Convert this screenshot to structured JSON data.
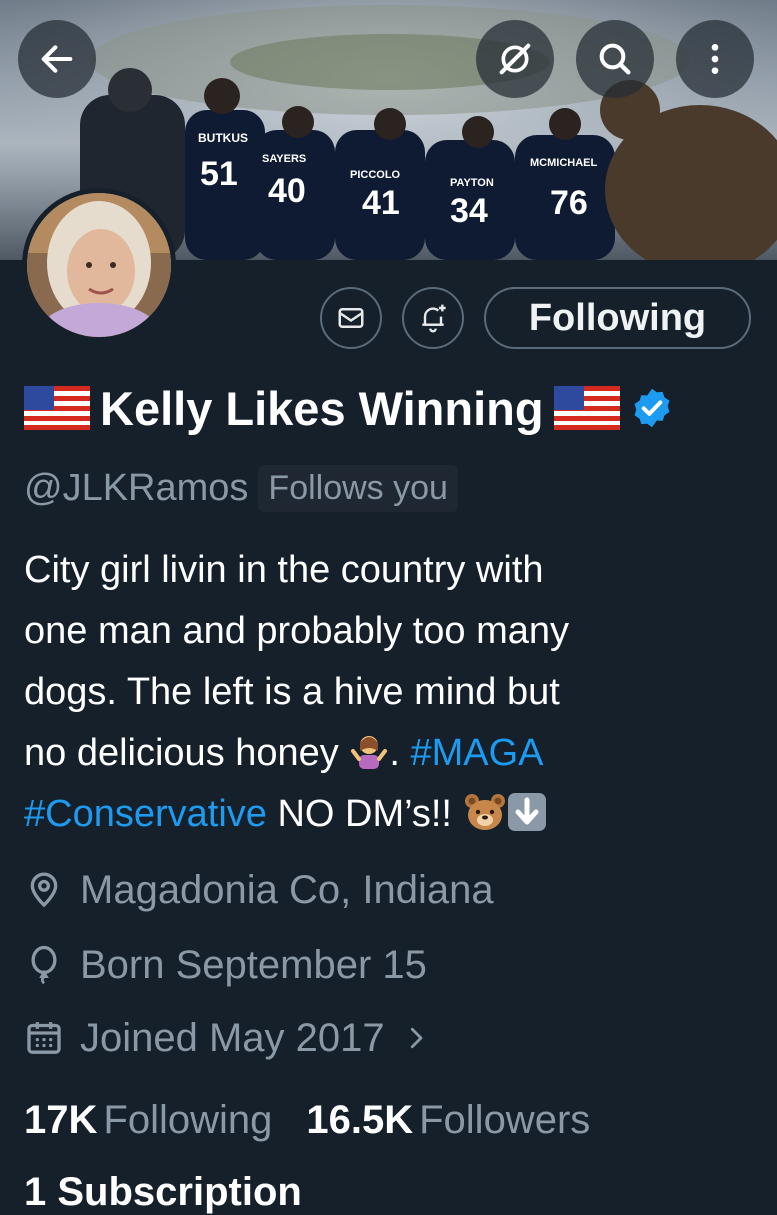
{
  "banner": {
    "jersey_names": [
      "BUTKUS",
      "SAYERS",
      "PICCOLO",
      "PAYTON",
      "MCMICHAEL"
    ],
    "jersey_numbers": [
      "51",
      "40",
      "41",
      "34",
      "76"
    ]
  },
  "profile": {
    "display_name": "Kelly Likes Winning",
    "handle": "@JLKRamos",
    "follows_you": "Follows you",
    "bio": {
      "line1": "City girl livin in the country with",
      "line2": "one man and probably too many",
      "line3": "dogs. The left is a hive mind but",
      "line4_a": "no delicious honey",
      "line4_b": ". ",
      "tag1": "#MAGA",
      "tag2": "#Conservative",
      "line5_b": " NO DM’s!! "
    },
    "location": "Magadonia Co, Indiana",
    "birthday": "Born September 15",
    "joined": "Joined May 2017",
    "following_count": "17K",
    "following_label": "Following",
    "followers_count": "16.5K",
    "followers_label": "Followers",
    "subscriptions_partial": "1 Subscription"
  },
  "buttons": {
    "following": "Following"
  },
  "icons": {
    "back": "back-arrow-icon",
    "grok": "grok-icon",
    "search": "search-icon",
    "more": "more-vertical-icon",
    "message": "envelope-icon",
    "notify": "bell-plus-icon",
    "verified": "verified-badge-icon",
    "location": "location-pin-icon",
    "birthday": "balloon-icon",
    "calendar": "calendar-icon"
  },
  "colors": {
    "background": "#15202b",
    "accent": "#1d9bf0",
    "muted": "#8b98a5"
  }
}
